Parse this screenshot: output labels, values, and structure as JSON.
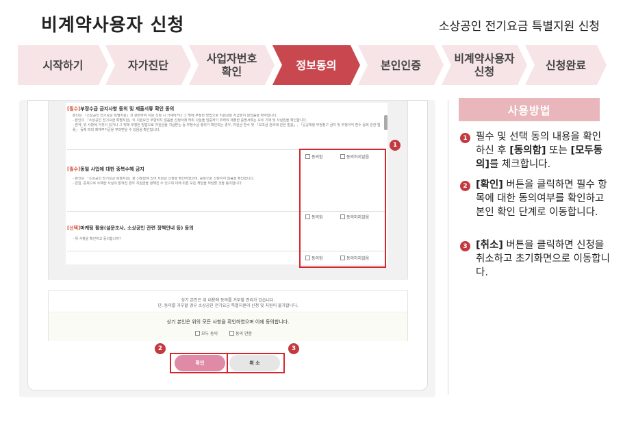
{
  "header": {
    "title": "비계약사용자 신청",
    "subtitle": "소상공인 전기요금 특별지원 신청"
  },
  "steps": [
    {
      "label": "시작하기"
    },
    {
      "label": "자가진단"
    },
    {
      "label": "사업자번호\n확인"
    },
    {
      "label": "정보동의"
    },
    {
      "label": "본인인증"
    },
    {
      "label": "비계약사용자\n신청"
    },
    {
      "label": "신청완료"
    }
  ],
  "colors": {
    "active_step": "#c9474f",
    "inactive_step": "#f6e4e6",
    "accent_red": "#d6262c",
    "confirm_button": "#df8aa6"
  },
  "form": {
    "sections": [
      {
        "tag": "[필수]",
        "title": "부정수급 금지사항 동의 및 제출서류 확인 동의",
        "body": "본인은 「소상공인 전기요금 특별지원」과 관련하여 지원 신청 시 기재하거나 그 밖에 부정한 방법으로 지원금을 지급받지 않았음을 확약합니다.\n- 본인이 「소상공인 전기요금 특별지원」의 지원요건 부합하지 않음을 신청서에 허위 사실을 입증하기 위하여 제출한 증명서류는 모두 기재 및 사실임을 확인합니다.\n- 만약, 위 사항에 거짓이 있거나 그 밖에 부정한 방법으로 지원금을 지급받는 등 부정수급 행위가 확인되는 경우, 지원금 환수 및 「보조금 관리에 관한 법률」, 「공공재정 부정청구 금지 및 부정이익 환수 등에 관한 법률」 등에 따라 제재부가금을 부과받을 수 있음을 확인합니다.",
        "agree": "동의함",
        "disagree": "동의하지않음"
      },
      {
        "tag": "[필수]",
        "title": "동일 사업에 대한 중복수혜 금지",
        "body": "- 본인은 「소상공인 전기요금 특별지원」을 신청함에 있어 지원금 신청을 확인하였으며, 중복으로 신청하지 않음을 확인합니다.\n- 만일, 중복으로 수혜한 사실이 밝혀진 경우 지원금을 정해진 수 있으며 이에 따른 모든 책임을 부담할 것을 동의합니다.",
        "agree": "동의함",
        "disagree": "동의하지않음"
      },
      {
        "tag": "[선택]",
        "title": "마케팅 활용(설문조사, 소상공인 관련 정책안내 등) 동의",
        "body": "- 위 사항을 확인하고 동의합니까?",
        "agree": "동의함",
        "disagree": "동의하지않음"
      }
    ],
    "notice_line1": "상기 본인은 위 내용에 동의를 거부할 권리가 있습니다.",
    "notice_line2": "단, 동의를 거부할 경우 소상공인 전기요금 특별지원의 신청 및 지원이 불가합니다.",
    "confirm_text": "상기 본인은 위의 모든 사항을 확인하였으며 이에 동의합니다.",
    "all_agree": "모두 동의",
    "all_disagree": "동의 안함",
    "confirm_button": "확인",
    "cancel_button": "취 소"
  },
  "callouts": [
    "1",
    "2",
    "3"
  ],
  "sidebar": {
    "heading": "사용방법",
    "items": [
      {
        "num": "1",
        "pre": "필수 및 선택 동의 내용을 확인 하신 후 ",
        "b1": "[동의함]",
        "mid": " 또는 ",
        "b2": "[모두동의]",
        "post": "를 체크합니다."
      },
      {
        "num": "2",
        "b1": "[확인]",
        "post": " 버튼을 클릭하면 필수 항목에 대한 동의여부를 확인하고 본인 확인 단계로 이동합니다."
      },
      {
        "num": "3",
        "b1": "[취소]",
        "post": " 버튼을 클릭하면 신청을 취소하고 초기화면으로 이동합니다."
      }
    ]
  }
}
